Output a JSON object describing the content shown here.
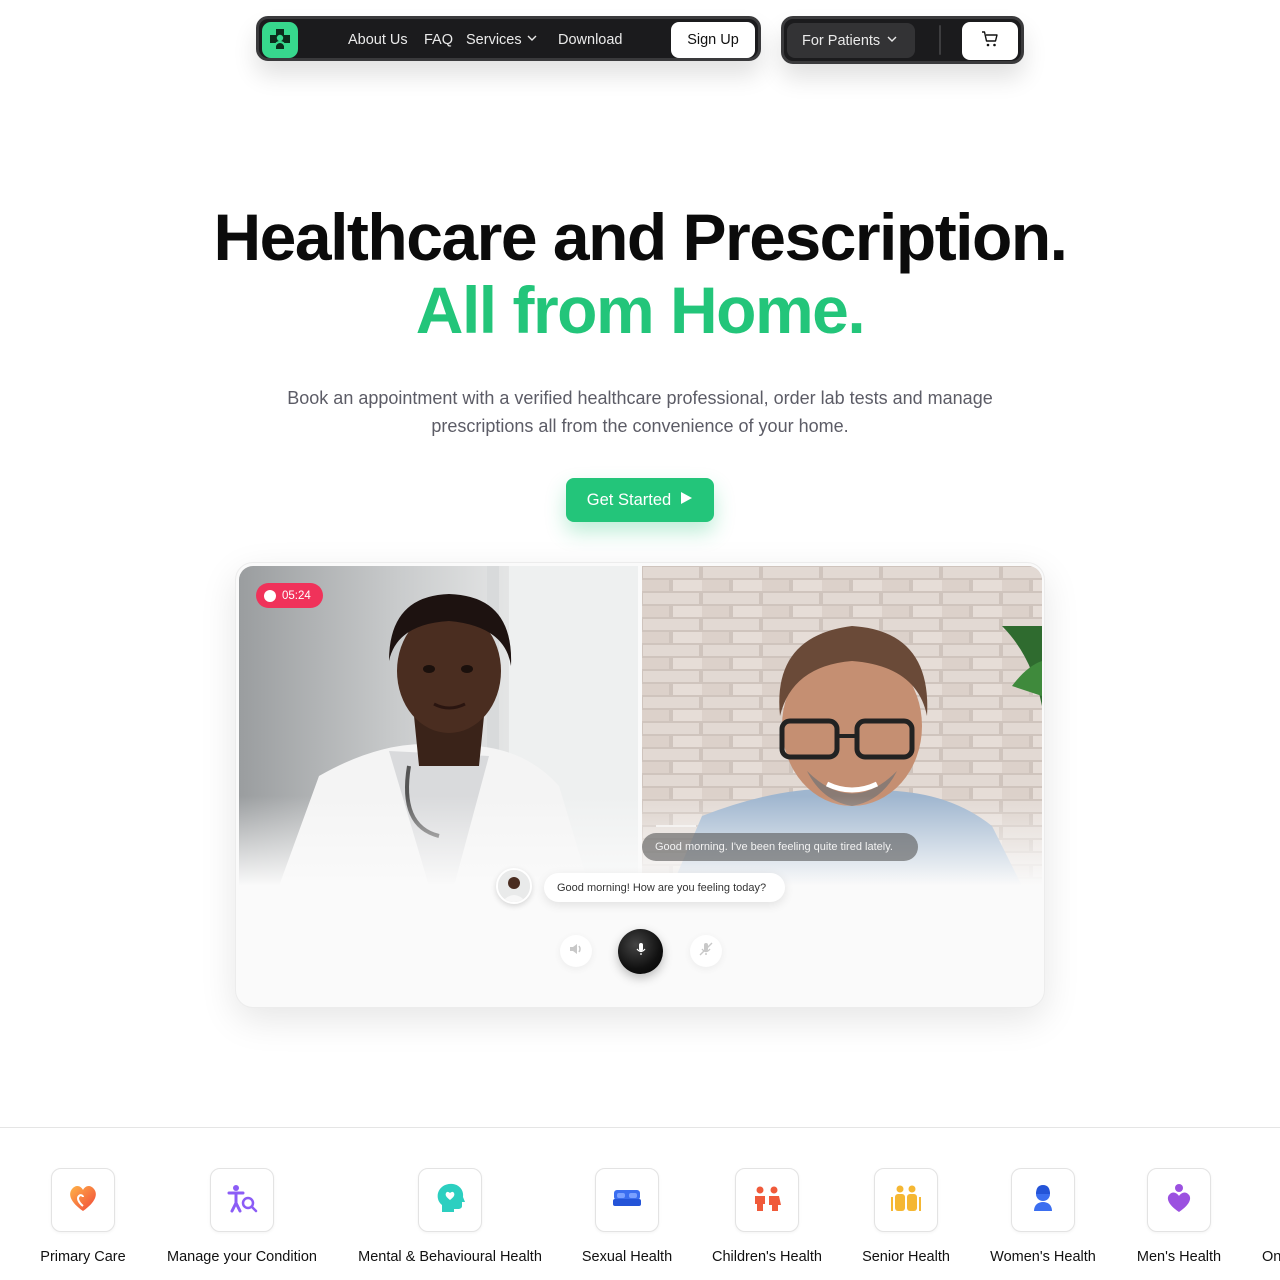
{
  "nav": {
    "links": [
      "About Us",
      "FAQ",
      "Services",
      "Download"
    ],
    "signup_label": "Sign Up",
    "audience_label": "For Patients"
  },
  "hero": {
    "title_line1": "Healthcare and Prescription.",
    "title_line2": "All from Home.",
    "subtitle": "Book an appointment with a verified healthcare professional, order lab tests and manage prescriptions all from the convenience of your home.",
    "cta_label": "Get Started"
  },
  "video_call": {
    "timer": "05:24",
    "patient_message": "Good morning. I've been feeling quite tired lately.",
    "doctor_message": "Good morning! How are you feeling today?"
  },
  "services": [
    {
      "label": "Primary Care",
      "icon": "heart-icon"
    },
    {
      "label": "Manage your Condition",
      "icon": "condition-search-icon"
    },
    {
      "label": "Mental & Behavioural Health",
      "icon": "head-heart-icon"
    },
    {
      "label": "Sexual Health",
      "icon": "bed-icon"
    },
    {
      "label": "Children's Health",
      "icon": "children-icon"
    },
    {
      "label": "Senior Health",
      "icon": "seniors-icon"
    },
    {
      "label": "Women's Health",
      "icon": "woman-icon"
    },
    {
      "label": "Men's Health",
      "icon": "man-heart-icon"
    },
    {
      "label": "On"
    }
  ],
  "colors": {
    "brand_green": "#23c57a",
    "nav_dark": "#1b1b1d",
    "recording_red": "#f0325a"
  }
}
